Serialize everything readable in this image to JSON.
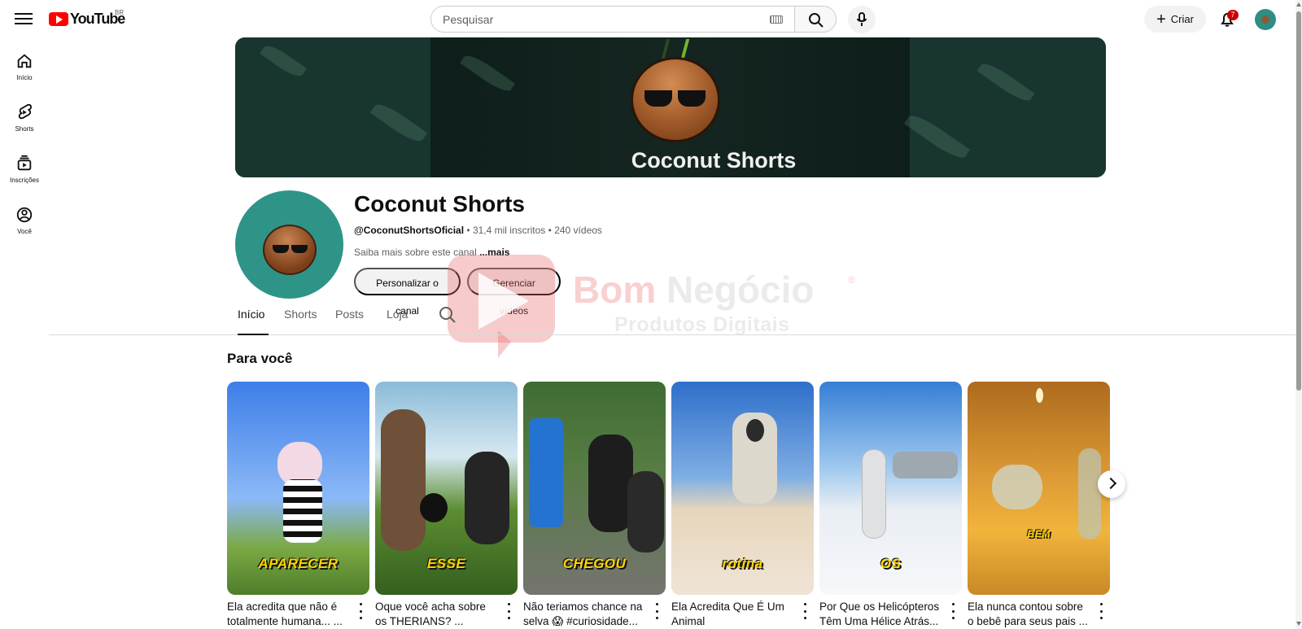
{
  "header": {
    "logo_text": "YouTube",
    "region": "BR",
    "search_placeholder": "Pesquisar",
    "create_label": "Criar",
    "notifications_count": "7"
  },
  "sidebar": {
    "items": [
      {
        "label": "Início",
        "icon": "home-icon"
      },
      {
        "label": "Shorts",
        "icon": "shorts-icon"
      },
      {
        "label": "Inscrições",
        "icon": "subscriptions-icon"
      },
      {
        "label": "Você",
        "icon": "user-icon"
      }
    ]
  },
  "channel": {
    "banner_title": "Coconut Shorts",
    "name": "Coconut Shorts",
    "handle": "@CoconutShortsOficial",
    "subscribers": "31,4 mil inscritos",
    "videos": "240 vídeos",
    "about": "Saiba mais sobre este canal ",
    "about_more": "...mais",
    "customize_label": "Personalizar o canal",
    "manage_label": "Gerenciar vídeos"
  },
  "watermark": {
    "brand_colored": "Bom ",
    "brand_light": "Negócio",
    "registered": "®",
    "subtitle": "Produtos Digitais"
  },
  "tabs": [
    {
      "label": "Início",
      "active": true
    },
    {
      "label": "Shorts",
      "active": false
    },
    {
      "label": "Posts",
      "active": false
    },
    {
      "label": "Loja",
      "active": false
    }
  ],
  "section": {
    "title": "Para você"
  },
  "shorts": [
    {
      "caption": "APARECER",
      "title": "Ela acredita que não é totalmente humana... ...",
      "colors": {
        "top": "#3d7ee8",
        "bottom": "#7aa944"
      }
    },
    {
      "caption": "ESSE",
      "title": "Oque você acha sobre os THERIANS? ...",
      "colors": {
        "top": "#8bbbd9",
        "bottom": "#4a7d2f"
      }
    },
    {
      "caption": "CHEGOU",
      "title": "Não teriamos chance na selva 😱 #curiosidade...",
      "colors": {
        "top": "#4f6f3d",
        "bottom": "#6c6d66"
      }
    },
    {
      "caption": "rotina",
      "title": "Ela Acredita Que É Um Animal",
      "colors": {
        "top": "#2e6fca",
        "bottom": "#e7d6bd"
      }
    },
    {
      "caption": "OS",
      "title": "Por Que os Helicópteros Têm Uma Hélice Atrás...",
      "colors": {
        "top": "#367ed5",
        "bottom": "#e9eef3"
      }
    },
    {
      "caption": "BEM",
      "title": "Ela nunca contou sobre o bebê para seus pais ...",
      "colors": {
        "top": "#ad6b1e",
        "bottom": "#f1b43b"
      }
    }
  ]
}
